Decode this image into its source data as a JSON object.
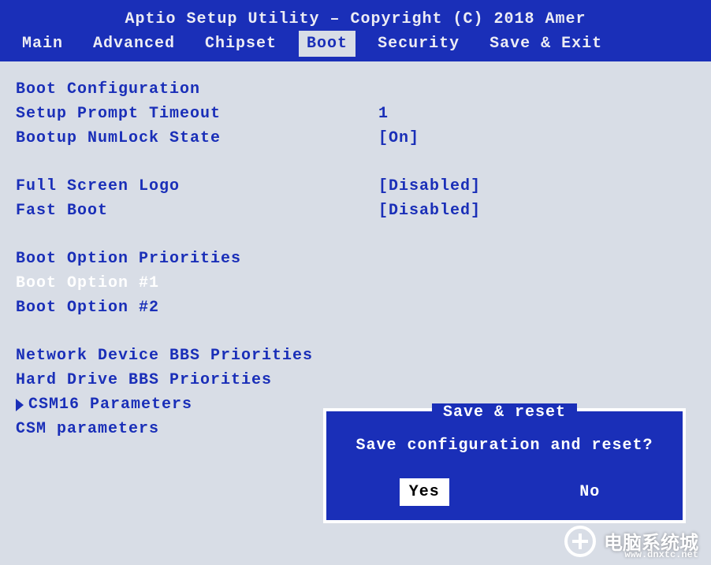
{
  "header": {
    "title": "Aptio Setup Utility – Copyright (C) 2018 Amer",
    "tabs": [
      "Main",
      "Advanced",
      "Chipset",
      "Boot",
      "Security",
      "Save & Exit"
    ],
    "active_tab_index": 3
  },
  "boot": {
    "section_title": "Boot Configuration",
    "items": [
      {
        "label": "Setup Prompt Timeout",
        "value": "1"
      },
      {
        "label": "Bootup NumLock State",
        "value": "[On]"
      }
    ],
    "items2": [
      {
        "label": "Full Screen Logo",
        "value": "[Disabled]"
      },
      {
        "label": "Fast Boot",
        "value": "[Disabled]"
      }
    ],
    "priorities_title": "Boot Option Priorities",
    "priorities": [
      {
        "label": "Boot Option #1",
        "highlight": true
      },
      {
        "label": "Boot Option #2",
        "highlight": false
      }
    ],
    "submenus": [
      "Network Device BBS Priorities",
      "Hard Drive BBS Priorities",
      "CSM16 Parameters",
      "CSM parameters"
    ],
    "active_submenu_index": 2
  },
  "dialog": {
    "title": "Save & reset",
    "message": "Save configuration and reset?",
    "yes": "Yes",
    "no": "No"
  },
  "watermark": {
    "text": "电脑系统城",
    "sub": "www.dnxtc.net"
  }
}
